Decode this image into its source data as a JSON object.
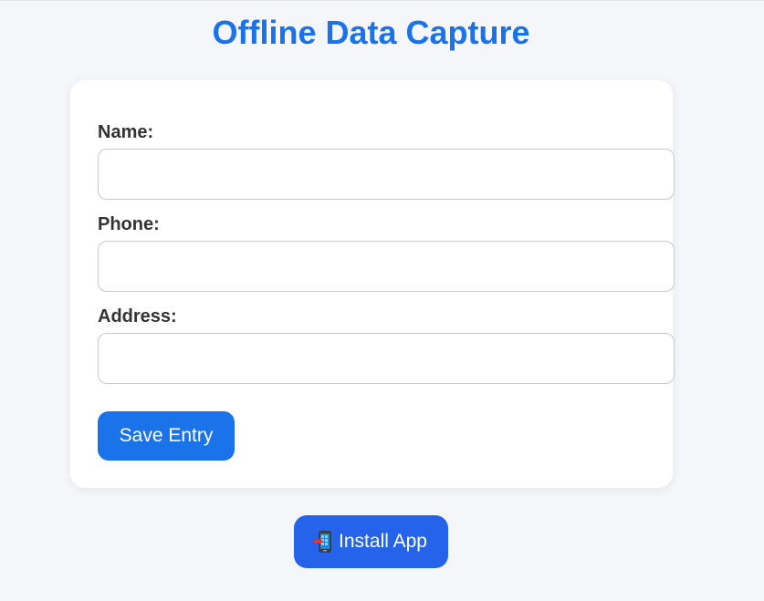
{
  "page": {
    "title": "Offline Data Capture"
  },
  "form": {
    "fields": [
      {
        "label": "Name:",
        "value": "",
        "placeholder": ""
      },
      {
        "label": "Phone:",
        "value": "",
        "placeholder": ""
      },
      {
        "label": "Address:",
        "value": "",
        "placeholder": ""
      }
    ],
    "save_label": "Save Entry"
  },
  "install": {
    "label": "Install App",
    "icon": "mobile-phone-with-arrow-icon"
  },
  "colors": {
    "background": "#f5f6fa",
    "title": "#1a73e8",
    "save_button": "#1a73e8",
    "install_button": "#2563eb",
    "label_text": "#333333",
    "input_border": "#c8c9cc"
  }
}
